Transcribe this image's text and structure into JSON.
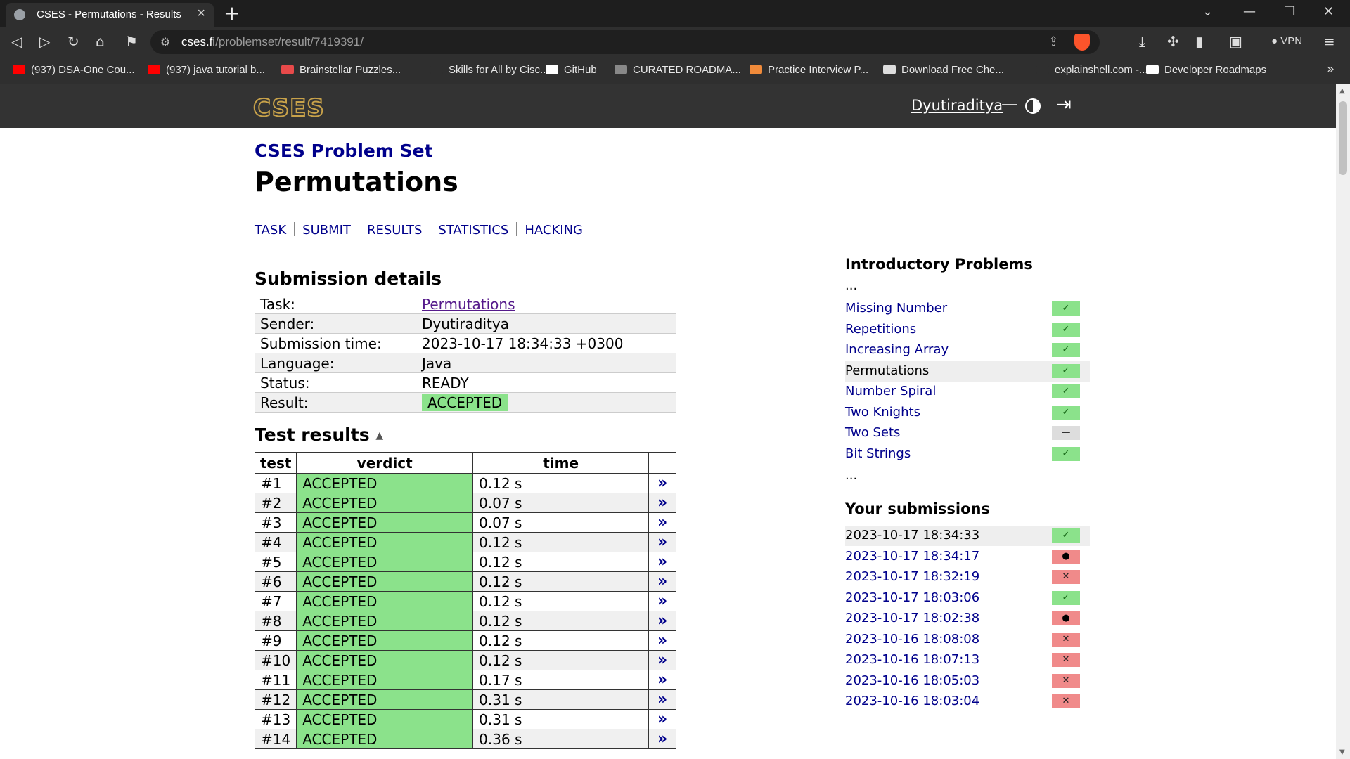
{
  "browser": {
    "tab_title": "CSES - Permutations - Results",
    "url_domain": "cses.fi",
    "url_path": "/problemset/result/7419391/",
    "vpn_label": "VPN",
    "bookmarks": [
      {
        "label": "(937) DSA-One Cou...",
        "icon": "youtube-icon",
        "color": "#ff0000"
      },
      {
        "label": "(937) java tutorial b...",
        "icon": "youtube-icon",
        "color": "#ff0000"
      },
      {
        "label": "Brainstellar Puzzles...",
        "icon": "star-icon",
        "color": "#e84a4a"
      },
      {
        "label": "Skills for All by Cisc...",
        "icon": "cisco-icon",
        "color": "#2f2f2f"
      },
      {
        "label": "GitHub",
        "icon": "github-icon",
        "color": "#ffffff"
      },
      {
        "label": "CURATED ROADMA...",
        "icon": "globe-icon",
        "color": "#888888"
      },
      {
        "label": "Practice Interview P...",
        "icon": "codechef-icon",
        "color": "#f08a3a"
      },
      {
        "label": "Download Free Che...",
        "icon": "chess-icon",
        "color": "#dddddd"
      },
      {
        "label": "explainshell.com -...",
        "icon": "shell-icon",
        "color": "#2f2f2f"
      },
      {
        "label": "Developer Roadmaps",
        "icon": "roadmap-icon",
        "color": "#ffffff"
      }
    ]
  },
  "site": {
    "logo": "CSES",
    "username": "Dyutiraditya",
    "dash": "—"
  },
  "page": {
    "breadcrumb": "CSES Problem Set",
    "title": "Permutations",
    "nav": [
      "TASK",
      "SUBMIT",
      "RESULTS",
      "STATISTICS",
      "HACKING"
    ]
  },
  "submission": {
    "heading": "Submission details",
    "rows": [
      {
        "key": "Task:",
        "value": "Permutations"
      },
      {
        "key": "Sender:",
        "value": "Dyutiraditya"
      },
      {
        "key": "Submission time:",
        "value": "2023-10-17 18:34:33 +0300"
      },
      {
        "key": "Language:",
        "value": "Java"
      },
      {
        "key": "Status:",
        "value": "READY"
      },
      {
        "key": "Result:",
        "value": "ACCEPTED"
      }
    ]
  },
  "tests": {
    "heading": "Test results",
    "caret": "▲",
    "columns": [
      "test",
      "verdict",
      "time"
    ],
    "link_glyph": "»",
    "rows": [
      {
        "test": "#1",
        "verdict": "ACCEPTED",
        "time": "0.12 s"
      },
      {
        "test": "#2",
        "verdict": "ACCEPTED",
        "time": "0.07 s"
      },
      {
        "test": "#3",
        "verdict": "ACCEPTED",
        "time": "0.07 s"
      },
      {
        "test": "#4",
        "verdict": "ACCEPTED",
        "time": "0.12 s"
      },
      {
        "test": "#5",
        "verdict": "ACCEPTED",
        "time": "0.12 s"
      },
      {
        "test": "#6",
        "verdict": "ACCEPTED",
        "time": "0.12 s"
      },
      {
        "test": "#7",
        "verdict": "ACCEPTED",
        "time": "0.12 s"
      },
      {
        "test": "#8",
        "verdict": "ACCEPTED",
        "time": "0.12 s"
      },
      {
        "test": "#9",
        "verdict": "ACCEPTED",
        "time": "0.12 s"
      },
      {
        "test": "#10",
        "verdict": "ACCEPTED",
        "time": "0.12 s"
      },
      {
        "test": "#11",
        "verdict": "ACCEPTED",
        "time": "0.17 s"
      },
      {
        "test": "#12",
        "verdict": "ACCEPTED",
        "time": "0.31 s"
      },
      {
        "test": "#13",
        "verdict": "ACCEPTED",
        "time": "0.31 s"
      },
      {
        "test": "#14",
        "verdict": "ACCEPTED",
        "time": "0.36 s"
      }
    ]
  },
  "sidebar": {
    "section_title": "Introductory Problems",
    "ellipsis": "...",
    "problems": [
      {
        "name": "Missing Number",
        "status": "ok",
        "current": false
      },
      {
        "name": "Repetitions",
        "status": "ok",
        "current": false
      },
      {
        "name": "Increasing Array",
        "status": "ok",
        "current": false
      },
      {
        "name": "Permutations",
        "status": "ok",
        "current": true
      },
      {
        "name": "Number Spiral",
        "status": "ok",
        "current": false
      },
      {
        "name": "Two Knights",
        "status": "ok",
        "current": false
      },
      {
        "name": "Two Sets",
        "status": "neutral",
        "current": false
      },
      {
        "name": "Bit Strings",
        "status": "ok",
        "current": false
      }
    ],
    "submissions_title": "Your submissions",
    "submissions": [
      {
        "time": "2023-10-17 18:34:33",
        "status": "ok",
        "current": true
      },
      {
        "time": "2023-10-17 18:34:17",
        "status": "err",
        "current": false
      },
      {
        "time": "2023-10-17 18:32:19",
        "status": "bad",
        "current": false
      },
      {
        "time": "2023-10-17 18:03:06",
        "status": "ok",
        "current": false
      },
      {
        "time": "2023-10-17 18:02:38",
        "status": "err",
        "current": false
      },
      {
        "time": "2023-10-16 18:08:08",
        "status": "bad",
        "current": false
      },
      {
        "time": "2023-10-16 18:07:13",
        "status": "bad",
        "current": false
      },
      {
        "time": "2023-10-16 18:05:03",
        "status": "bad",
        "current": false
      },
      {
        "time": "2023-10-16 18:03:04",
        "status": "bad",
        "current": false
      }
    ],
    "glyphs": {
      "ok": "✓",
      "neutral": "—",
      "bad": "✕",
      "err": "●"
    }
  }
}
